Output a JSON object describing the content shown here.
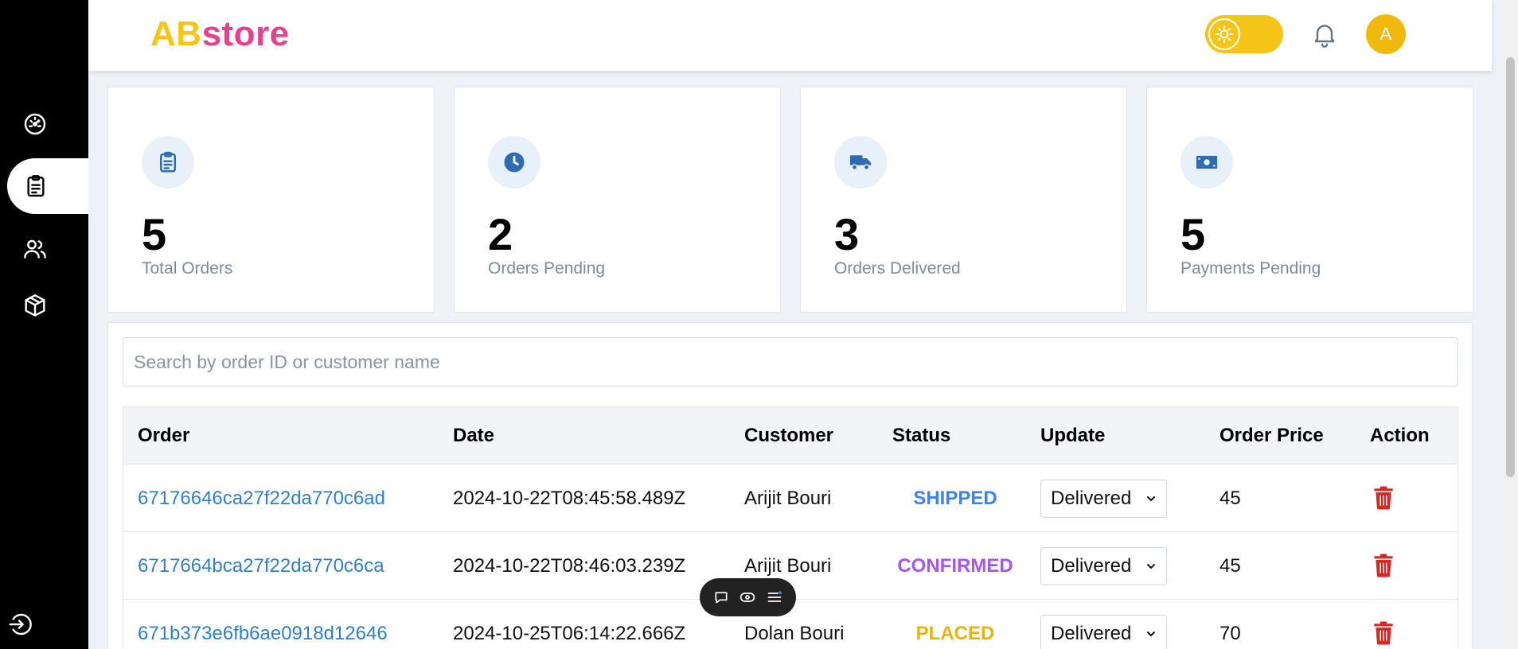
{
  "app": {
    "logo_part1": "AB",
    "logo_part2": "store",
    "avatar_initial": "A",
    "colors": {
      "accent_yellow": "#f5c518",
      "accent_pink": "#e6408f",
      "link_blue": "#2f7fd0",
      "delete_red": "#dc2626"
    }
  },
  "sidebar": {
    "items": [
      {
        "icon": "dashboard-icon",
        "active": false
      },
      {
        "icon": "clipboard-icon",
        "active": true
      },
      {
        "icon": "users-icon",
        "active": false
      },
      {
        "icon": "box-icon",
        "active": false
      }
    ],
    "logout_icon": "logout-icon"
  },
  "stats": [
    {
      "value": "5",
      "label": "Total Orders",
      "icon": "clipboard-icon"
    },
    {
      "value": "2",
      "label": "Orders Pending",
      "icon": "clock-icon"
    },
    {
      "value": "3",
      "label": "Orders Delivered",
      "icon": "truck-icon"
    },
    {
      "value": "5",
      "label": "Payments Pending",
      "icon": "money-icon"
    }
  ],
  "search": {
    "placeholder": "Search by order ID or customer name",
    "value": ""
  },
  "table": {
    "headers": {
      "order": "Order",
      "date": "Date",
      "customer": "Customer",
      "status": "Status",
      "update": "Update",
      "price": "Order Price",
      "action": "Action"
    },
    "rows": [
      {
        "order": "67176646ca27f22da770c6ad",
        "date": "2024-10-22T08:45:58.489Z",
        "customer": "Arijit Bouri",
        "status": "SHIPPED",
        "status_color": "#3b82f6",
        "update": "Delivered",
        "price": "45"
      },
      {
        "order": "6717664bca27f22da770c6ca",
        "date": "2024-10-22T08:46:03.239Z",
        "customer": "Arijit Bouri",
        "status": "CONFIRMED",
        "status_color": "#a855f7",
        "update": "Delivered",
        "price": "45"
      },
      {
        "order": "671b373e6fb6ae0918d12646",
        "date": "2024-10-25T06:14:22.666Z",
        "customer": "Dolan Bouri",
        "status": "PLACED",
        "status_color": "#eab308",
        "update": "Delivered",
        "price": "70"
      }
    ]
  },
  "floating_toolbar": {
    "icons": [
      "chat-icon",
      "eye-icon",
      "menu-icon"
    ]
  }
}
